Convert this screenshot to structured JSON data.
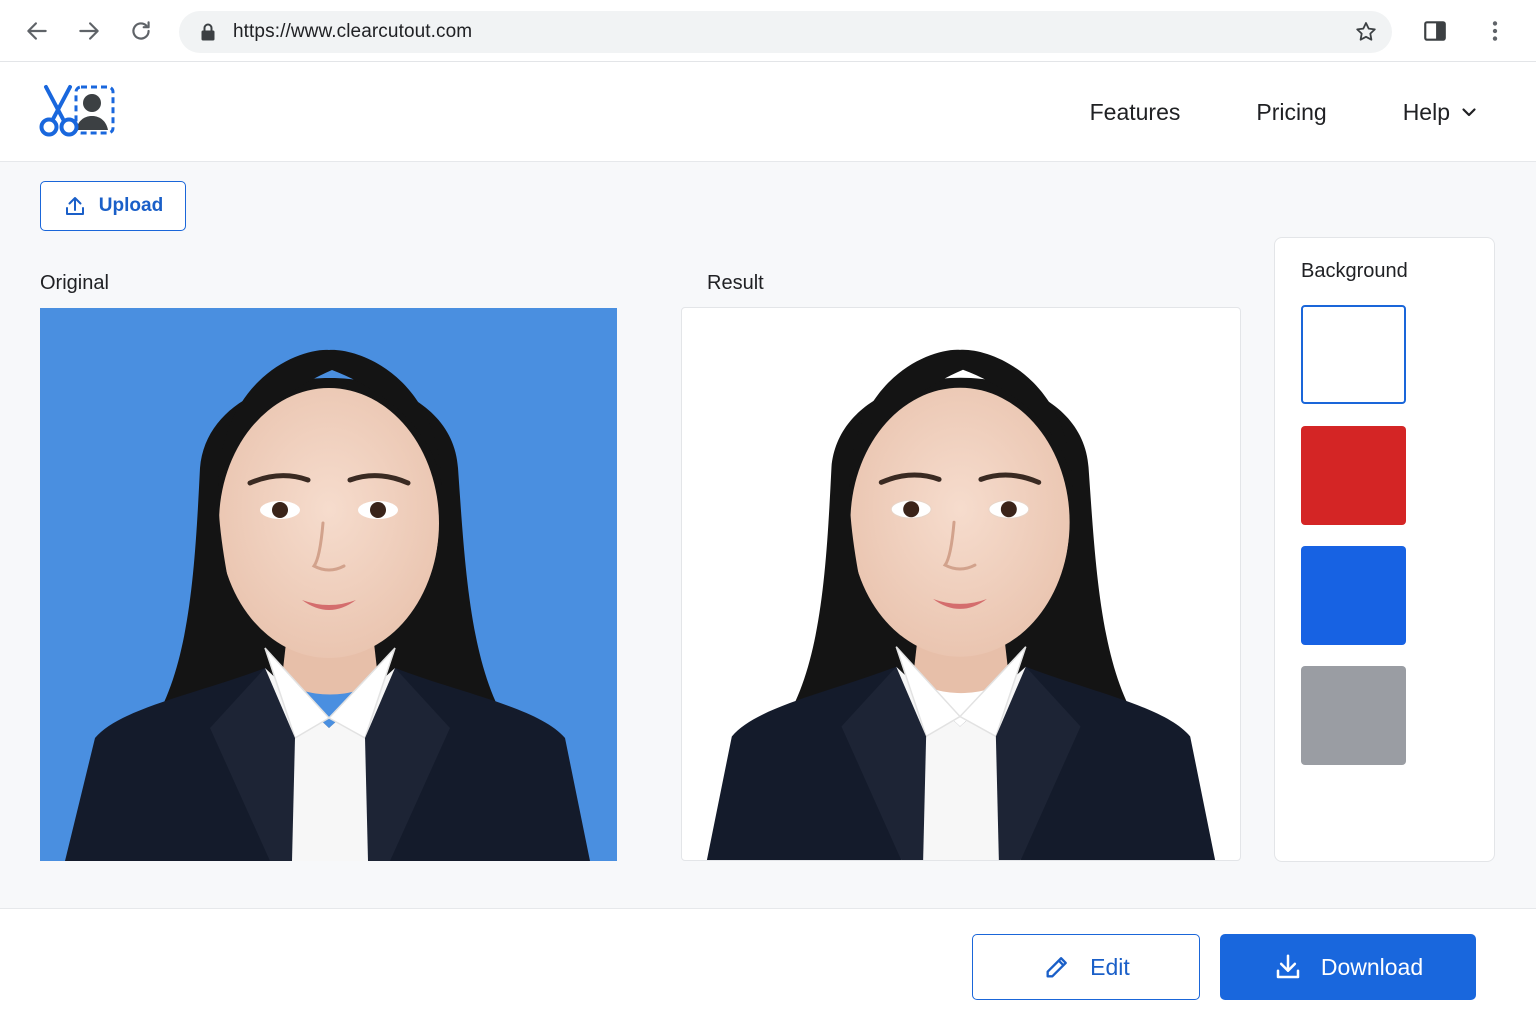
{
  "browser": {
    "url": "https://www.clearcutout.com",
    "icons": [
      "back-arrow-icon",
      "forward-arrow-icon",
      "reload-icon",
      "lock-icon",
      "star-icon",
      "sidebar-icon",
      "more-vert-icon"
    ]
  },
  "header": {
    "logo_icon": "scissors-portrait-logo",
    "nav": {
      "features": "Features",
      "pricing": "Pricing",
      "help": "Help"
    }
  },
  "main": {
    "upload_label": "Upload",
    "original_label": "Original",
    "result_label": "Result",
    "original_background": "#4a8fe0",
    "result_background": "#ffffff"
  },
  "background_panel": {
    "title": "Background",
    "swatches": [
      {
        "name": "white",
        "color": "#ffffff",
        "selected": true
      },
      {
        "name": "red",
        "color": "#d42525",
        "selected": false
      },
      {
        "name": "blue",
        "color": "#1762e3",
        "selected": false
      },
      {
        "name": "gray",
        "color": "#9a9da3",
        "selected": false
      }
    ]
  },
  "footer": {
    "edit_label": "Edit",
    "download_label": "Download"
  },
  "colors": {
    "accent": "#1967dd",
    "accent_text": "#1a5fc8"
  }
}
